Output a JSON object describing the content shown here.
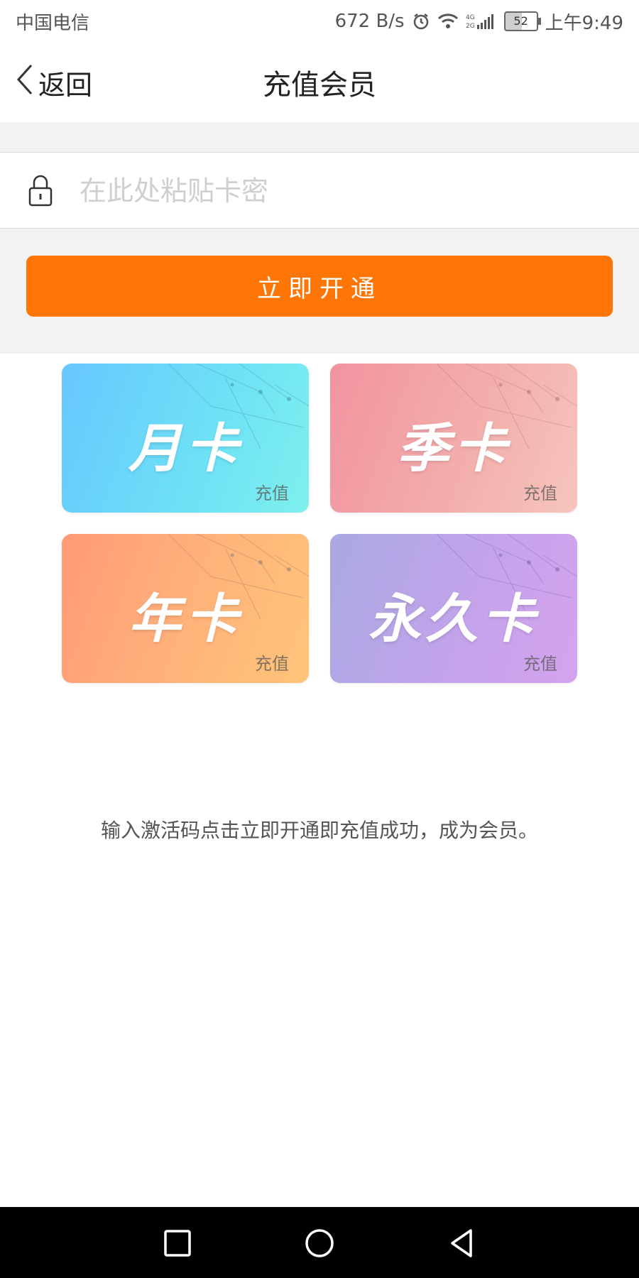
{
  "status_bar": {
    "carrier": "中国电信",
    "speed": "672 B/s",
    "network": "4G 2G",
    "battery": "52",
    "time": "上午9:49"
  },
  "nav": {
    "back_label": "返回",
    "title": "充值会员"
  },
  "form": {
    "placeholder": "在此处粘贴卡密",
    "value": "",
    "submit_label": "立即开通"
  },
  "cards": [
    {
      "name": "月卡",
      "tag": "充值"
    },
    {
      "name": "季卡",
      "tag": "充值"
    },
    {
      "name": "年卡",
      "tag": "充值"
    },
    {
      "name": "永久卡",
      "tag": "充值"
    }
  ],
  "hint": "输入激活码点击立即开通即充值成功，成为会员。",
  "colors": {
    "accent": "#ff7506",
    "background_band": "#f2f2f2",
    "month_card": "#67c6ff",
    "season_card": "#f2939f",
    "year_card": "#ff9a78",
    "forever_card": "#b7a4e8"
  },
  "icons": {
    "back": "chevron-left-icon",
    "lock": "lock-icon",
    "alarm": "alarm-icon",
    "wifi": "wifi-icon",
    "signal": "signal-icon",
    "battery": "battery-icon",
    "sys_recent": "square-recent-icon",
    "sys_home": "circle-home-icon",
    "sys_back": "triangle-back-icon"
  }
}
